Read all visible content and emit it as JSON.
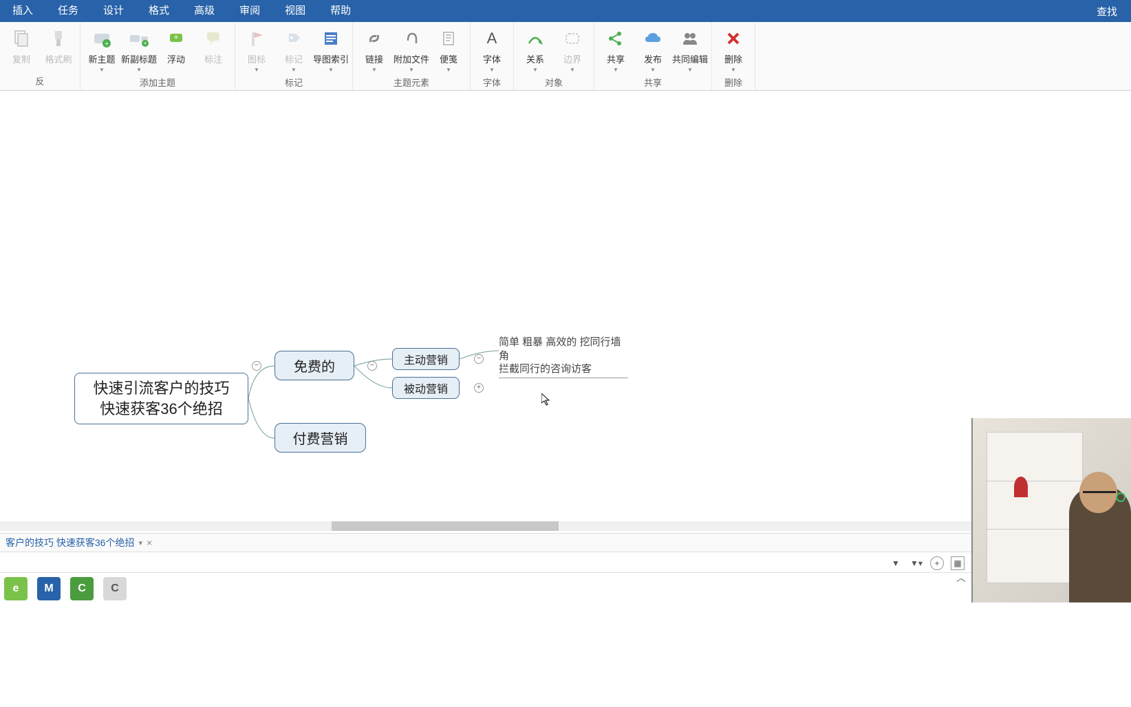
{
  "menu": {
    "tabs": [
      "插入",
      "任务",
      "设计",
      "格式",
      "高级",
      "审阅",
      "视图",
      "帮助"
    ],
    "find": "查找"
  },
  "ribbon": {
    "groups": [
      {
        "label": "",
        "items": [
          {
            "id": "copy",
            "text": "复制",
            "disabled": true,
            "arrow": false
          },
          {
            "id": "format-painter",
            "text": "格式刷",
            "disabled": true,
            "arrow": false
          }
        ]
      },
      {
        "label": "添加主题",
        "items": [
          {
            "id": "new-topic",
            "text": "新主题",
            "arrow": true
          },
          {
            "id": "new-subtopic",
            "text": "新副标题",
            "arrow": true
          },
          {
            "id": "floating",
            "text": "浮动",
            "arrow": false
          },
          {
            "id": "callout",
            "text": "标注",
            "disabled": true,
            "arrow": false
          }
        ]
      },
      {
        "label": "标记",
        "items": [
          {
            "id": "icon",
            "text": "图标",
            "disabled": true,
            "arrow": true
          },
          {
            "id": "tag",
            "text": "标记",
            "disabled": true,
            "arrow": true
          },
          {
            "id": "map-index",
            "text": "导图索引",
            "arrow": true
          }
        ]
      },
      {
        "label": "主题元素",
        "launcher": true,
        "items": [
          {
            "id": "link",
            "text": "链接",
            "arrow": true
          },
          {
            "id": "attach",
            "text": "附加文件",
            "arrow": true
          },
          {
            "id": "note",
            "text": "便笺",
            "arrow": true
          }
        ]
      },
      {
        "label": "字体",
        "items": [
          {
            "id": "font",
            "text": "字体",
            "arrow": true
          }
        ]
      },
      {
        "label": "对象",
        "items": [
          {
            "id": "relation",
            "text": "关系",
            "arrow": true
          },
          {
            "id": "boundary",
            "text": "边界",
            "disabled": true,
            "arrow": true
          }
        ]
      },
      {
        "label": "共享",
        "items": [
          {
            "id": "share",
            "text": "共享",
            "arrow": true
          },
          {
            "id": "publish",
            "text": "发布",
            "arrow": true
          },
          {
            "id": "coedit",
            "text": "共同编辑",
            "arrow": true
          }
        ]
      },
      {
        "label": "删除",
        "items": [
          {
            "id": "delete",
            "text": "删除",
            "arrow": true
          }
        ]
      }
    ]
  },
  "mindmap": {
    "root": "快速引流客户的技巧\n快速获客36个绝招",
    "free": "免费的",
    "paid": "付费营销",
    "active": "主动营销",
    "passive": "被动营销",
    "detail": "简单 粗暴 高效的  挖同行墙角\n拦截同行的咨询访客",
    "toggles": {
      "minus1": "−",
      "minus2": "−",
      "plus": "+"
    }
  },
  "bottom": {
    "tabname": "客户的技巧 快速获客36个绝招",
    "close": "×"
  }
}
